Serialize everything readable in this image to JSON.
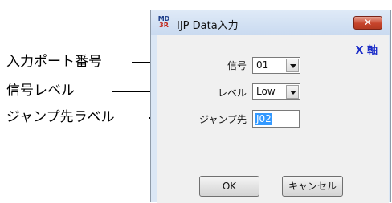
{
  "annotations": {
    "input_port_number": "入力ポート番号",
    "signal_level": "信号レベル",
    "jump_label": "ジャンプ先ラベル"
  },
  "dialog": {
    "icon_text_top": "MD",
    "icon_text_bottom": "3R",
    "title": "IJP Data入力",
    "close_glyph": "✕",
    "axis_label": "X 軸",
    "signal_label": "信号",
    "signal_value": "01",
    "level_label": "レベル",
    "level_value": "Low",
    "jump_label": "ジャンプ先",
    "jump_value": "J02",
    "ok_label": "OK",
    "cancel_label": "キャンセル"
  }
}
